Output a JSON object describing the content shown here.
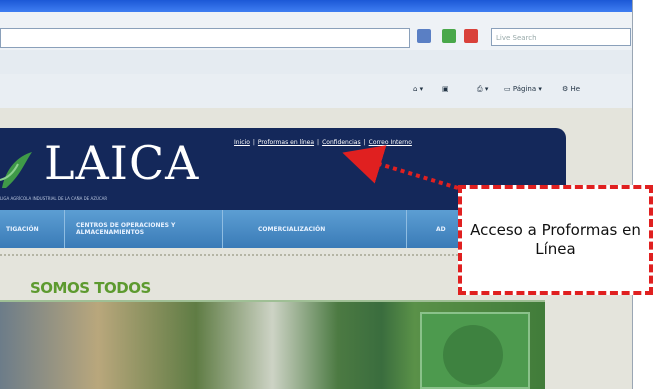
{
  "browser": {
    "search_placeholder": "Live Search",
    "commands": {
      "page_label": "Página",
      "help_label": "He"
    }
  },
  "site": {
    "logo": "LAICA",
    "tagline": "LIGA AGRÍCOLA INDUSTRIAL DE LA CAÑA DE AZÚCAR",
    "top_links": [
      "Inicio",
      "Proformas en línea",
      "Confidencias",
      "Correo Interno"
    ],
    "nav": [
      {
        "label": "TIGACIÓN"
      },
      {
        "label": "CENTROS DE OPERACIONES Y ALMACENAMIENTOS"
      },
      {
        "label": "COMERCIALIZACIÓN"
      },
      {
        "label": "AD"
      }
    ],
    "banner_heading": "SOMOS TODOS"
  },
  "callout": {
    "text": "Acceso a Proformas en Línea",
    "color": "#e02020"
  },
  "colors": {
    "header_bg": "#14285a",
    "nav_bg": "#3a7bb7",
    "heading_green": "#5d9a2f"
  }
}
